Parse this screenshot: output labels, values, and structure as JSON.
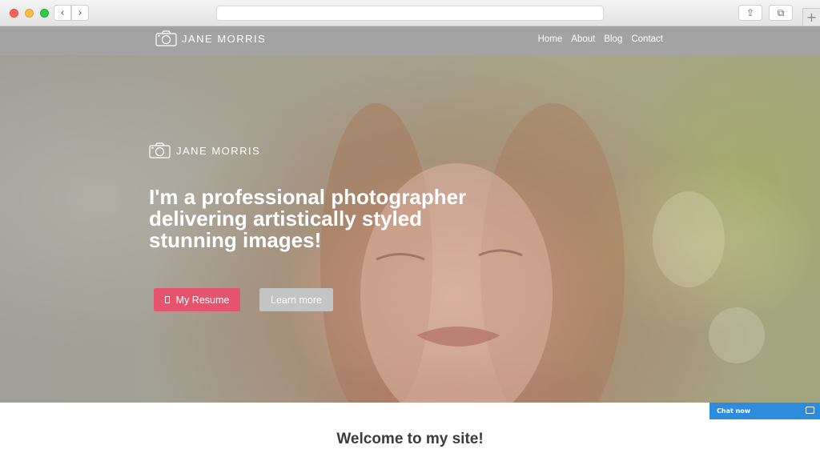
{
  "browser": {
    "back_icon": "‹",
    "forward_icon": "›",
    "share_icon": "⇪",
    "tabs_icon": "⧉",
    "new_tab_icon": "+"
  },
  "site": {
    "brand": "JANE MORRIS",
    "nav": [
      "Home",
      "About",
      "Blog",
      "Contact"
    ]
  },
  "hero": {
    "brand": "JANE MORRIS",
    "headline": "I'm a professional photographer delivering artistically styled stunning images!",
    "primary_button": "My Resume",
    "secondary_button": "Learn more"
  },
  "welcome": "Welcome to my site!",
  "chat": {
    "label": "Chat now"
  },
  "colors": {
    "accent": "#e5546c",
    "header_bg": "#a3a3a3",
    "chat_bg": "#2d8cdb"
  }
}
